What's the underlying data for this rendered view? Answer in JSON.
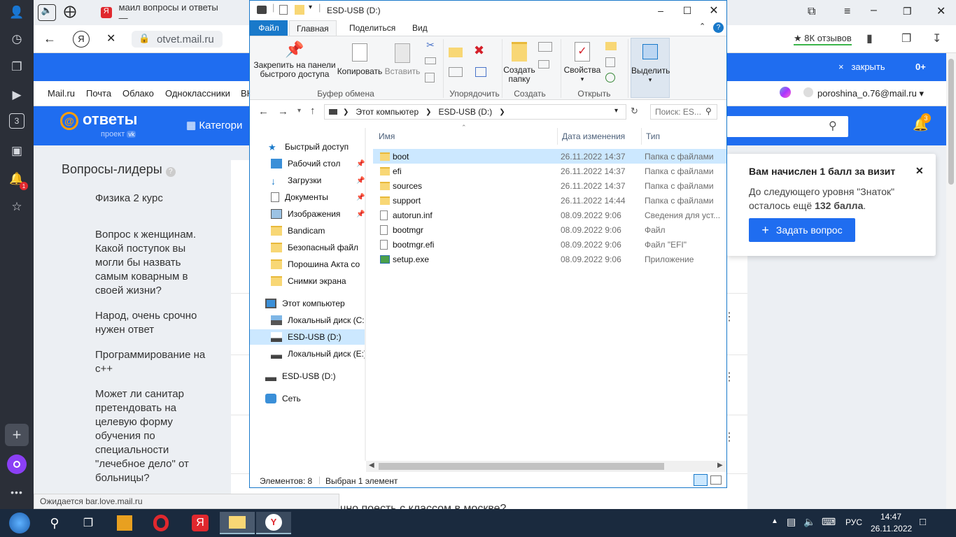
{
  "browser": {
    "tabs": [
      {
        "label": "маил вопросы и ответы —"
      }
    ],
    "address": "otvet.mail.ru",
    "reviews": "8К отзывов",
    "blue_bar": {
      "close_label": "закрыть",
      "plus": "0+"
    },
    "mail_nav": [
      "Mail.ru",
      "Почта",
      "Облако",
      "Одноклассники",
      "ВК"
    ],
    "user_email": "poroshina_o.76@mail.ru",
    "status_text": "Ожидается bar.love.mail.ru",
    "rail_badge": "1",
    "rail_tab_number": "3"
  },
  "site": {
    "logo": "ответы",
    "logo_sub": "проект",
    "logo_badge": "vk",
    "categories_label": "Категори",
    "bell_badge": "3",
    "leaders_title": "Вопросы-лидеры",
    "leaders": [
      "Физика 2 курс",
      "Вопрос к женщинам. Какой поступок вы могли бы назвать самым коварным в своей жизни?",
      "Народ, очень срочно нужен ответ",
      "Программирование на с++",
      "Может ли санитар претендовать на целевую форму обучения по специальности \"лечебное дело\" от больницы?"
    ],
    "bottom_question_fragment": "чно поесть с классом в москве?",
    "notification": {
      "title": "Вам начислен 1 балл за визит",
      "text_before": "До следующего уровня \"Знаток\" осталось ещё ",
      "points": "132 балла",
      "text_after": ".",
      "button": "Задать вопрос"
    }
  },
  "explorer": {
    "title": "ESD-USB (D:)",
    "ribbon_tabs": [
      "Файл",
      "Главная",
      "Поделиться",
      "Вид"
    ],
    "ribbon": {
      "pin": "Закрепить на панели быстрого доступа",
      "copy": "Копировать",
      "paste": "Вставить",
      "new_folder": "Создать папку",
      "properties": "Свойства",
      "select": "Выделить",
      "groups": [
        "Буфер обмена",
        "Упорядочить",
        "Создать",
        "Открыть"
      ]
    },
    "path": [
      "Этот компьютер",
      "ESD-USB (D:)"
    ],
    "search_placeholder": "Поиск: ES...",
    "nav": [
      {
        "label": "Быстрый доступ",
        "icon": "star-icon"
      },
      {
        "label": "Рабочий стол",
        "icon": "desktop-icon"
      },
      {
        "label": "Загрузки",
        "icon": "download-icon"
      },
      {
        "label": "Документы",
        "icon": "documents-icon"
      },
      {
        "label": "Изображения",
        "icon": "pictures-icon"
      },
      {
        "label": "Bandicam",
        "icon": "folder-icon"
      },
      {
        "label": "Безопасный файл",
        "icon": "folder-icon"
      },
      {
        "label": "Порошина Акта со",
        "icon": "folder-icon"
      },
      {
        "label": "Снимки экрана",
        "icon": "folder-icon"
      },
      {
        "label": "Этот компьютер",
        "icon": "computer-icon"
      },
      {
        "label": "Локальный диск (C:",
        "icon": "disk-icon"
      },
      {
        "label": "ESD-USB (D:)",
        "icon": "usb-drive-icon"
      },
      {
        "label": "Локальный диск (E:)",
        "icon": "disk-icon"
      },
      {
        "label": "ESD-USB (D:)",
        "icon": "usb-drive-icon"
      },
      {
        "label": "Сеть",
        "icon": "network-icon"
      }
    ],
    "columns": [
      "Имя",
      "Дата изменения",
      "Тип"
    ],
    "files": [
      {
        "name": "boot",
        "date": "26.11.2022 14:37",
        "type": "Папка с файлами",
        "kind": "folder"
      },
      {
        "name": "efi",
        "date": "26.11.2022 14:37",
        "type": "Папка с файлами",
        "kind": "folder"
      },
      {
        "name": "sources",
        "date": "26.11.2022 14:37",
        "type": "Папка с файлами",
        "kind": "folder"
      },
      {
        "name": "support",
        "date": "26.11.2022 14:44",
        "type": "Папка с файлами",
        "kind": "folder"
      },
      {
        "name": "autorun.inf",
        "date": "08.09.2022 9:06",
        "type": "Сведения для уст...",
        "kind": "doc"
      },
      {
        "name": "bootmgr",
        "date": "08.09.2022 9:06",
        "type": "Файл",
        "kind": "doc"
      },
      {
        "name": "bootmgr.efi",
        "date": "08.09.2022 9:06",
        "type": "Файл \"EFI\"",
        "kind": "doc"
      },
      {
        "name": "setup.exe",
        "date": "08.09.2022 9:06",
        "type": "Приложение",
        "kind": "exe"
      }
    ],
    "status_count": "Элементов: 8",
    "status_selected": "Выбран 1 элемент"
  },
  "taskbar": {
    "lang": "РУС",
    "time": "14:47",
    "date": "26.11.2022"
  },
  "colors": {
    "mail_blue": "#1f6df0",
    "explorer_accent": "#1979ca",
    "selection": "#cce8ff",
    "taskbar": "#1a2a3e"
  }
}
